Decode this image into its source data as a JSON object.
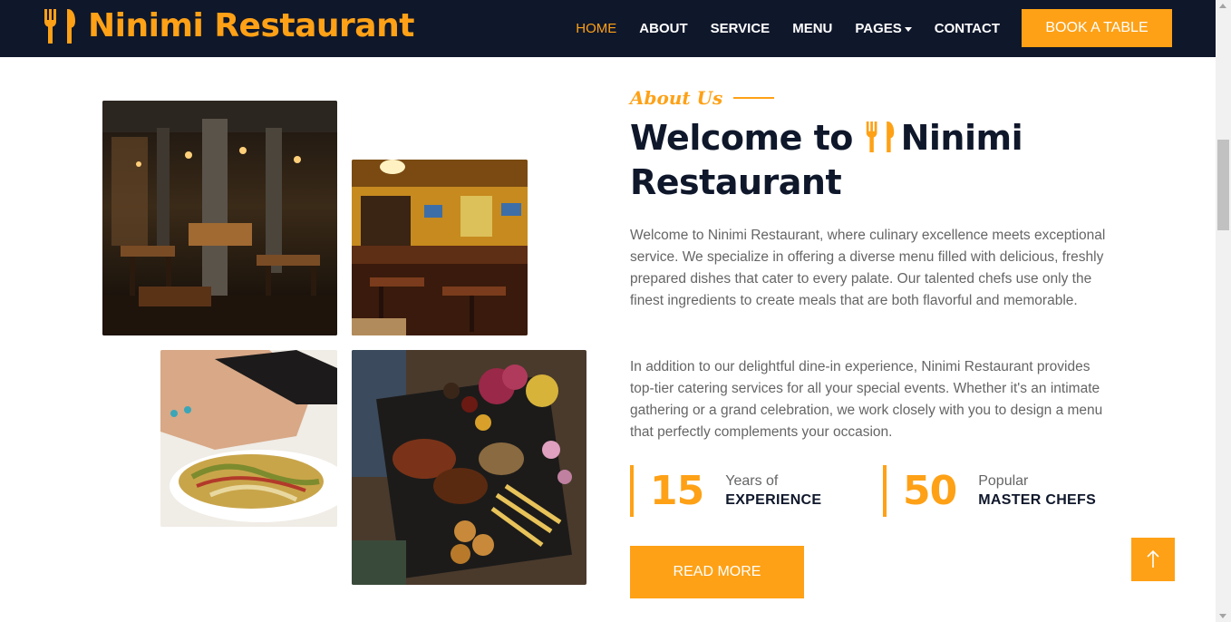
{
  "colors": {
    "accent": "#fea116",
    "navy": "#0f172b",
    "body_text": "#666565"
  },
  "navbar": {
    "brand": "Ninimi Restaurant",
    "brand_icon": "utensils-icon",
    "links": [
      {
        "label": "HOME",
        "active": true
      },
      {
        "label": "ABOUT"
      },
      {
        "label": "SERVICE"
      },
      {
        "label": "MENU"
      },
      {
        "label": "PAGES"
      },
      {
        "label": "CONTACT"
      }
    ],
    "cta": "BOOK A TABLE"
  },
  "gallery": [
    {
      "alt": "restaurant-interior-dark"
    },
    {
      "alt": "restaurant-bar-interior"
    },
    {
      "alt": "salad-plate-hand"
    },
    {
      "alt": "grilled-platter-top-view"
    }
  ],
  "about": {
    "label": "About Us",
    "heading_part1": "Welcome to",
    "heading_part2": "Ninimi",
    "heading_part3": "Restaurant",
    "paragraph1": "Welcome to Ninimi Restaurant, where culinary excellence meets exceptional service. We specialize in offering a diverse menu filled with delicious, freshly prepared dishes that cater to every palate. Our talented chefs use only the finest ingredients to create meals that are both flavorful and memorable.",
    "paragraph2": "In addition to our delightful dine-in experience, Ninimi Restaurant provides top-tier catering services for all your special events. Whether it's an intimate gathering or a grand celebration, we work closely with you to design a menu that perfectly complements your occasion.",
    "stats": [
      {
        "number": "15",
        "line1": "Years of",
        "line2": "EXPERIENCE"
      },
      {
        "number": "50",
        "line1": "Popular",
        "line2": "MASTER CHEFS"
      }
    ],
    "read_more": "READ MORE"
  },
  "back_to_top_icon": "arrow-up-icon"
}
